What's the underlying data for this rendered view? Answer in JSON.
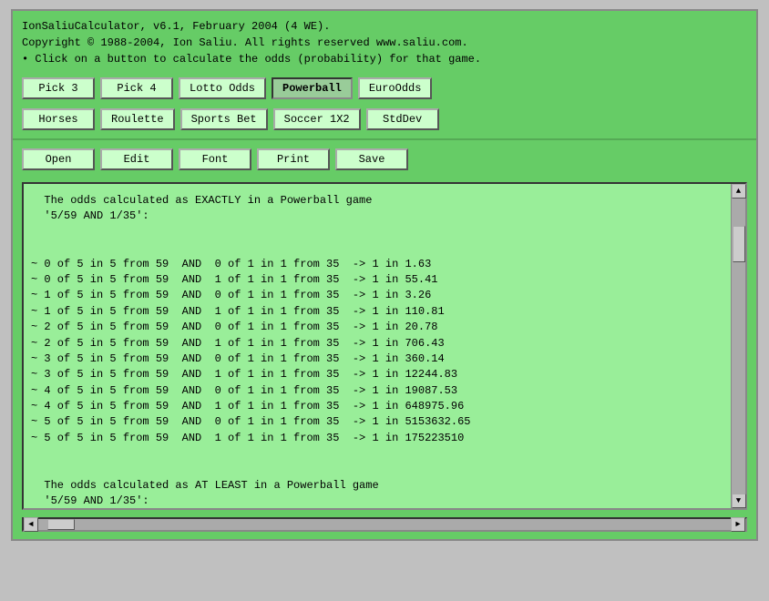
{
  "app": {
    "title_line1": "IonSaliuCalculator, v6.1, February 2004 (4 WE).",
    "title_line2": "Copyright © 1988-2004, Ion Saliu. All rights reserved www.saliu.com.",
    "title_line3": "• Click on a button to calculate the odds (probability) for that game."
  },
  "buttons_row1": [
    {
      "label": "Pick 3",
      "id": "pick3",
      "active": false
    },
    {
      "label": "Pick 4",
      "id": "pick4",
      "active": false
    },
    {
      "label": "Lotto Odds",
      "id": "lotto",
      "active": false
    },
    {
      "label": "Powerball",
      "id": "powerball",
      "active": true
    },
    {
      "label": "EuroOdds",
      "id": "euroodds",
      "active": false
    }
  ],
  "buttons_row2": [
    {
      "label": "Horses",
      "id": "horses",
      "active": false
    },
    {
      "label": "Roulette",
      "id": "roulette",
      "active": false
    },
    {
      "label": "Sports Bet",
      "id": "sportsbet",
      "active": false
    },
    {
      "label": "Soccer 1X2",
      "id": "soccer",
      "active": false
    },
    {
      "label": "StdDev",
      "id": "stddev",
      "active": false
    }
  ],
  "buttons_row3": [
    {
      "label": "Open",
      "id": "open",
      "active": false
    },
    {
      "label": "Edit",
      "id": "edit",
      "active": false
    },
    {
      "label": "Font",
      "id": "font",
      "active": false
    },
    {
      "label": "Print",
      "id": "print",
      "active": false
    },
    {
      "label": "Save",
      "id": "save",
      "active": false
    }
  ],
  "output": {
    "content": "  The odds calculated as EXACTLY in a Powerball game\n  '5/59 AND 1/35':\n\n\n~ 0 of 5 in 5 from 59  AND  0 of 1 in 1 from 35  -> 1 in 1.63\n~ 0 of 5 in 5 from 59  AND  1 of 1 in 1 from 35  -> 1 in 55.41\n~ 1 of 5 in 5 from 59  AND  0 of 1 in 1 from 35  -> 1 in 3.26\n~ 1 of 5 in 5 from 59  AND  1 of 1 in 1 from 35  -> 1 in 110.81\n~ 2 of 5 in 5 from 59  AND  0 of 1 in 1 from 35  -> 1 in 20.78\n~ 2 of 5 in 5 from 59  AND  1 of 1 in 1 from 35  -> 1 in 706.43\n~ 3 of 5 in 5 from 59  AND  0 of 1 in 1 from 35  -> 1 in 360.14\n~ 3 of 5 in 5 from 59  AND  1 of 1 in 1 from 35  -> 1 in 12244.83\n~ 4 of 5 in 5 from 59  AND  0 of 1 in 1 from 35  -> 1 in 19087.53\n~ 4 of 5 in 5 from 59  AND  1 of 1 in 1 from 35  -> 1 in 648975.96\n~ 5 of 5 in 5 from 59  AND  0 of 1 in 1 from 35  -> 1 in 5153632.65\n~ 5 of 5 in 5 from 59  AND  1 of 1 in 1 from 35  -> 1 in 175223510\n\n\n  The odds calculated as AT LEAST in a Powerball game\n  '5/59 AND 1/35':"
  },
  "scrollbar": {
    "up_arrow": "▲",
    "down_arrow": "▼",
    "left_arrow": "◄",
    "right_arrow": "►"
  }
}
